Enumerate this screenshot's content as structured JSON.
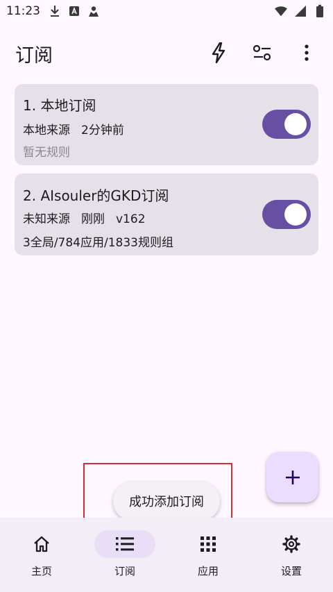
{
  "status_bar": {
    "time": "11:23"
  },
  "header": {
    "title": "订阅",
    "actions": [
      "lightning-icon",
      "filter-icon",
      "more-vert-icon"
    ]
  },
  "subscriptions": [
    {
      "title": "1. 本地订阅",
      "source": "本地来源",
      "updated": "2分钟前",
      "version": "",
      "summary": "暂无规则",
      "enabled": true
    },
    {
      "title": "2. AIsouler的GKD订阅",
      "source": "未知来源",
      "updated": "刚刚",
      "version": "v162",
      "summary": "3全局/784应用/1833规则组",
      "enabled": true
    }
  ],
  "toast": {
    "message": "成功添加订阅"
  },
  "bottom_nav": {
    "items": [
      {
        "label": "主页",
        "icon": "home-icon",
        "active": false
      },
      {
        "label": "订阅",
        "icon": "list-icon",
        "active": true
      },
      {
        "label": "应用",
        "icon": "apps-grid-icon",
        "active": false
      },
      {
        "label": "设置",
        "icon": "settings-icon",
        "active": false
      }
    ]
  },
  "colors": {
    "background": "#fef7ff",
    "card": "#e6e0e9",
    "accent": "#6750a4",
    "fab": "#eaddff",
    "nav_bar": "#f3edf7",
    "nav_active": "#e8def8",
    "highlight": "#d32f2f"
  }
}
